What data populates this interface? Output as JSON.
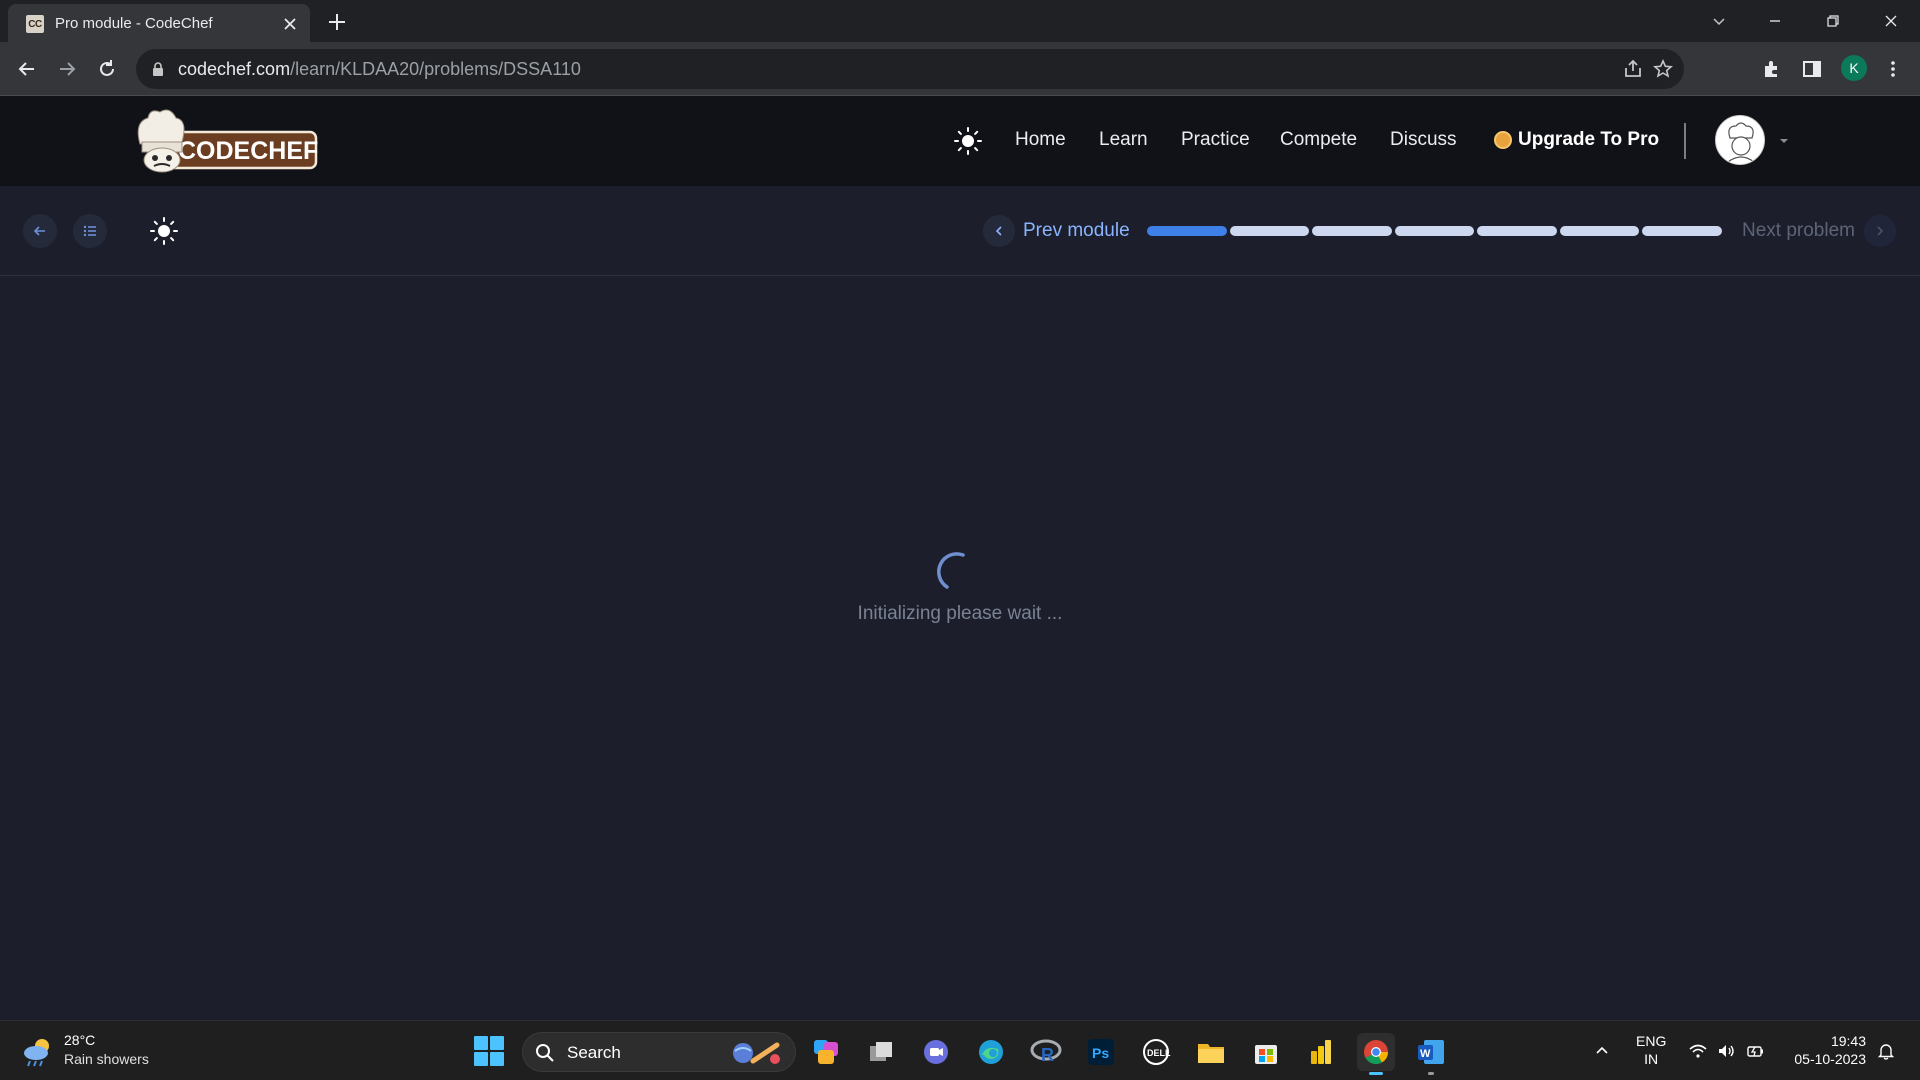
{
  "browser": {
    "tab_title": "Pro module - CodeChef",
    "favicon_text": "CC",
    "url_host": "codechef.com",
    "url_path": "/learn/KLDAA20/problems/DSSA110",
    "profile_initial": "K"
  },
  "site": {
    "logo_text": "CODECHEF",
    "nav": {
      "home": "Home",
      "learn": "Learn",
      "practice": "Practice",
      "compete": "Compete",
      "discuss": "Discuss"
    },
    "upgrade_label": "Upgrade To Pro"
  },
  "module_bar": {
    "prev_label": "Prev module",
    "next_label": "Next problem",
    "progress": {
      "segments_total": 7,
      "segments_done": 1
    }
  },
  "loading": {
    "message": "Initializing please wait ..."
  },
  "taskbar": {
    "weather_temp": "28°C",
    "weather_desc": "Rain showers",
    "search_label": "Search",
    "lang_line1": "ENG",
    "lang_line2": "IN",
    "time": "19:43",
    "date": "05-10-2023"
  },
  "colors": {
    "page_bg": "#1c1f2b",
    "header_bg": "#111218",
    "accent_blue": "#3f7fe8",
    "link_blue": "#8ab4ff",
    "progress_track": "#cdd7ef"
  }
}
